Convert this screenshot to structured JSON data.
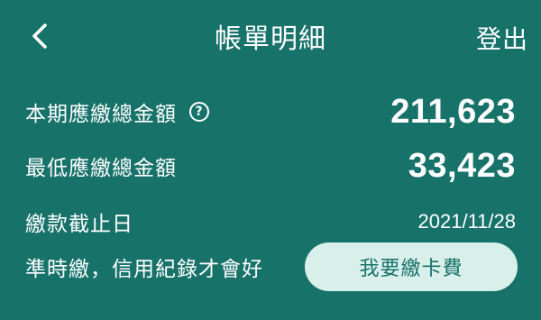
{
  "header": {
    "back_icon": "chevron-left-icon",
    "title": "帳單明細",
    "logout_label": "登出"
  },
  "summary": {
    "total_due_label": "本期應繳總金額",
    "help_icon": "question-circle-icon",
    "help_glyph": "?",
    "total_due_value": "211,623",
    "minimum_due_label": "最低應繳總金額",
    "minimum_due_value": "33,423",
    "due_date_label": "繳款截止日",
    "due_date_value": "2021/11/28",
    "reminder_text": "準時繳，信用紀錄才會好",
    "pay_button_label": "我要繳卡費"
  },
  "colors": {
    "background": "#17726a",
    "text": "#ffffff",
    "button_background": "#d9efea",
    "button_text": "#17726a"
  }
}
